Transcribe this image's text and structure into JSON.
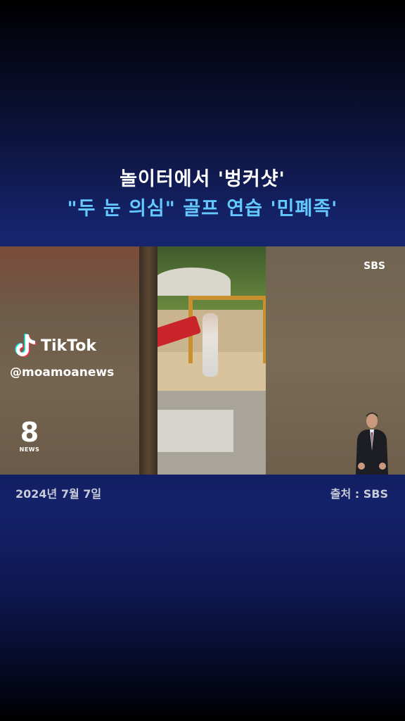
{
  "headline": {
    "line1": "놀이터에서 '벙커샷'",
    "line2": "\"두 눈 의심\" 골프 연습 '민폐족'"
  },
  "video": {
    "broadcaster_logo": "SBS",
    "news_logo_number": "8",
    "news_logo_label": "NEWS"
  },
  "overlay": {
    "platform": "TikTok",
    "handle": "@moamoanews"
  },
  "footer": {
    "date": "2024년 7월 7일",
    "source": "출처 : SBS"
  },
  "colors": {
    "headline_line1": "#ffffff",
    "headline_line2": "#64c9ff",
    "band_blue": "#16256e"
  },
  "icons": [
    "tiktok-logo-icon",
    "sign-language-interpreter"
  ]
}
